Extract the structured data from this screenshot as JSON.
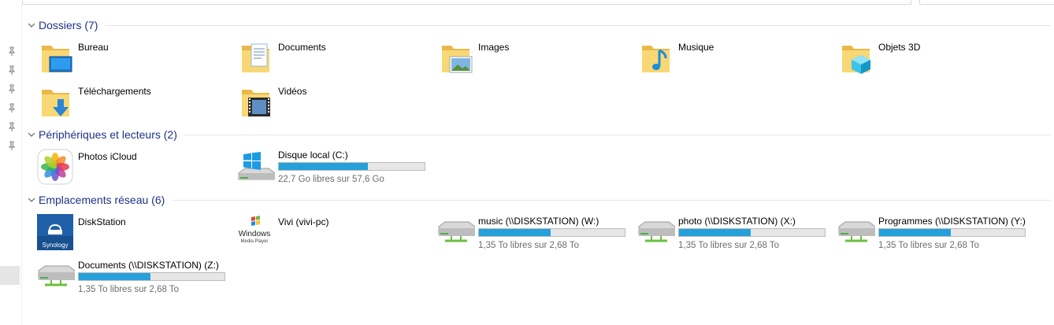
{
  "groups": [
    {
      "label": "Dossiers (7)"
    },
    {
      "label": "Périphériques et lecteurs (2)"
    },
    {
      "label": "Emplacements réseau (6)"
    }
  ],
  "folders": [
    {
      "name": "Bureau",
      "icon": "desktop-folder-icon"
    },
    {
      "name": "Documents",
      "icon": "documents-folder-icon"
    },
    {
      "name": "Images",
      "icon": "pictures-folder-icon"
    },
    {
      "name": "Musique",
      "icon": "music-folder-icon"
    },
    {
      "name": "Objets 3D",
      "icon": "3d-objects-folder-icon"
    },
    {
      "name": "Téléchargements",
      "icon": "downloads-folder-icon"
    },
    {
      "name": "Vidéos",
      "icon": "videos-folder-icon"
    }
  ],
  "devices": [
    {
      "name": "Photos iCloud",
      "icon": "icloud-photos-icon"
    },
    {
      "name": "Disque local (C:)",
      "icon": "local-disk-icon",
      "free": "22,7 Go libres sur 57,6 Go",
      "used_fraction": 0.61
    }
  ],
  "network": [
    {
      "name": "DiskStation",
      "icon": "synology-icon"
    },
    {
      "name": "Vivi (vivi-pc)",
      "icon": "windows-media-player-icon"
    },
    {
      "name": "music (\\\\DISKSTATION) (W:)",
      "icon": "network-drive-icon",
      "free": "1,35 To libres sur 2,68 To",
      "used_fraction": 0.49
    },
    {
      "name": "photo (\\\\DISKSTATION) (X:)",
      "icon": "network-drive-icon",
      "free": "1,35 To libres sur 2,68 To",
      "used_fraction": 0.49
    },
    {
      "name": "Programmes (\\\\DISKSTATION) (Y:)",
      "icon": "network-drive-icon",
      "free": "1,35 To libres sur 2,68 To",
      "used_fraction": 0.49
    },
    {
      "name": "Documents (\\\\DISKSTATION) (Z:)",
      "icon": "network-drive-icon",
      "free": "1,35 To libres sur 2,68 To",
      "used_fraction": 0.49
    }
  ],
  "colors": {
    "group_header": "#1e3287",
    "usage_bar": "#26a0da",
    "folder": "#f8d775"
  }
}
